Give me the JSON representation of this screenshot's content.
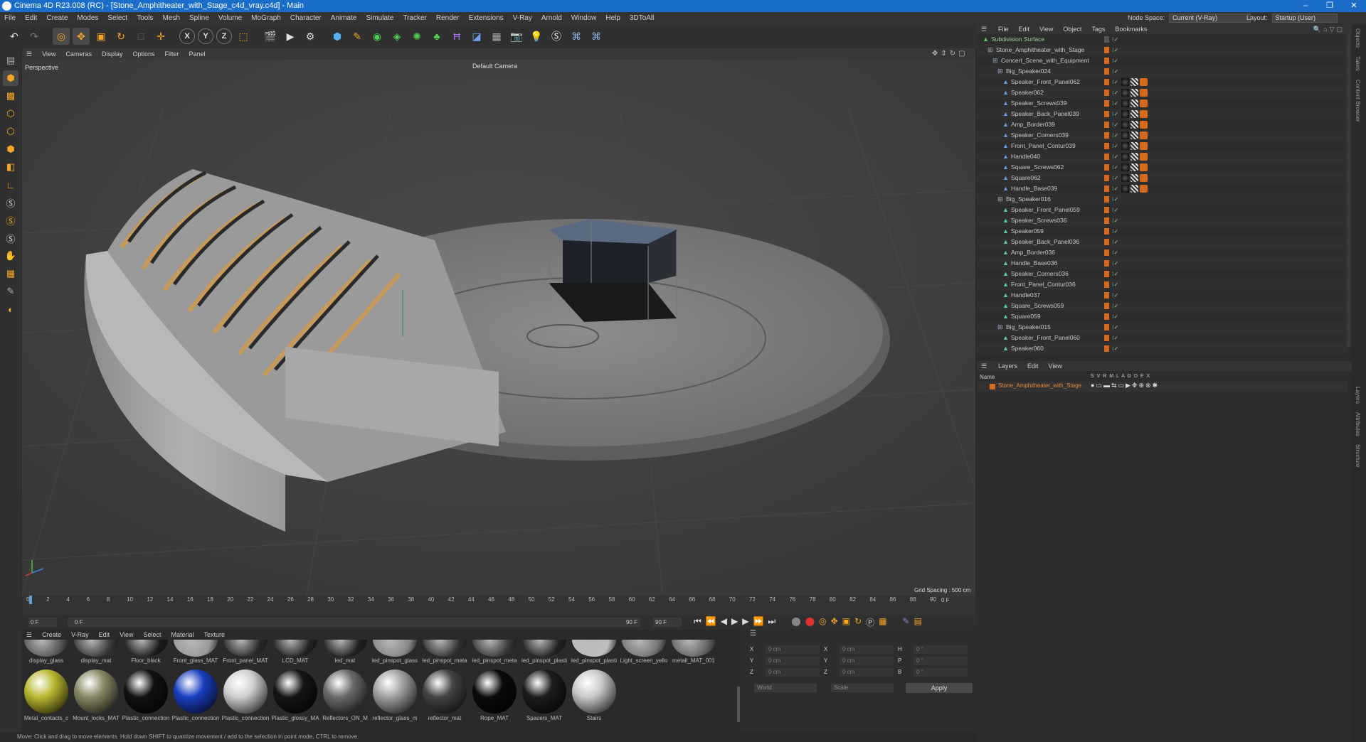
{
  "window": {
    "title": "Cinema 4D R23.008 (RC) - [Stone_Amphitheater_with_Stage_c4d_vray.c4d] - Main",
    "controls": [
      "–",
      "❐",
      "✕"
    ]
  },
  "menubar": {
    "items": [
      "File",
      "Edit",
      "Create",
      "Modes",
      "Select",
      "Tools",
      "Mesh",
      "Spline",
      "Volume",
      "MoGraph",
      "Character",
      "Animate",
      "Simulate",
      "Tracker",
      "Render",
      "Extensions",
      "V-Ray",
      "Arnold",
      "Window",
      "Help",
      "3DToAll"
    ],
    "node_space_label": "Node Space:",
    "node_space_value": "Current (V-Ray)",
    "layout_label": "Layout:",
    "layout_value": "Startup (User)"
  },
  "toolbar": {
    "axis": [
      "X",
      "Y",
      "Z"
    ]
  },
  "viewport": {
    "menu": [
      "View",
      "Cameras",
      "Display",
      "Options",
      "Filter",
      "Panel"
    ],
    "projection": "Perspective",
    "camera": "Default Camera",
    "grid_spacing": "Grid Spacing : 500 cm"
  },
  "timeline": {
    "ticks": [
      "0",
      "2",
      "4",
      "6",
      "8",
      "10",
      "12",
      "14",
      "16",
      "18",
      "20",
      "22",
      "24",
      "26",
      "28",
      "30",
      "32",
      "34",
      "36",
      "38",
      "40",
      "42",
      "44",
      "46",
      "48",
      "50",
      "52",
      "54",
      "56",
      "58",
      "60",
      "62",
      "64",
      "66",
      "68",
      "70",
      "72",
      "74",
      "76",
      "78",
      "80",
      "82",
      "84",
      "86",
      "88",
      "90"
    ],
    "frame_end_label": "0 F",
    "current_a": "0 F",
    "current_b": "0 F",
    "end_a": "90 F",
    "end_b": "90 F"
  },
  "materials": {
    "menu": [
      "Create",
      "V-Ray",
      "Edit",
      "View",
      "Select",
      "Material",
      "Texture"
    ],
    "row1": [
      {
        "name": "display_glass",
        "color": "#5a5a5a"
      },
      {
        "name": "display_mat",
        "color": "#3a3a3a"
      },
      {
        "name": "Floor_black",
        "color": "#1a1a1a"
      },
      {
        "name": "Front_glass_MAT",
        "color": "#9a9a9a"
      },
      {
        "name": "Front_panel_MAT",
        "color": "#2a2a2a"
      },
      {
        "name": "LCD_MAT",
        "color": "#222222"
      },
      {
        "name": "led_mat",
        "color": "#1e1e1e"
      },
      {
        "name": "led_pinspot_glass",
        "color": "#888888"
      },
      {
        "name": "led_pinspot_meta",
        "color": "#333333"
      },
      {
        "name": "led_pinspot_meta",
        "color": "#3a3a3a"
      },
      {
        "name": "led_pinspot_plasti",
        "color": "#222222"
      },
      {
        "name": "led_pinspot_plasti",
        "color": "#bdbdbd"
      },
      {
        "name": "Light_screen_yello",
        "color": "#777777"
      },
      {
        "name": "metall_MAT_001",
        "color": "#666666"
      }
    ],
    "row2": [
      {
        "name": "Metal_contacts_c",
        "color": "#b8b830"
      },
      {
        "name": "Mount_locks_MAT",
        "color": "#888866"
      },
      {
        "name": "Plastic_connection",
        "color": "#111111"
      },
      {
        "name": "Plastic_connection",
        "color": "#1a3fc0"
      },
      {
        "name": "Plastic_connection",
        "color": "#cfcfcf"
      },
      {
        "name": "Plastic_glossy_MA",
        "color": "#151515"
      },
      {
        "name": "Reflectors_ON_M",
        "color": "#6a6a6a"
      },
      {
        "name": "reflector_glass_m",
        "color": "#a0a0a0"
      },
      {
        "name": "reflector_mat",
        "color": "#444444"
      },
      {
        "name": "Rope_MAT",
        "color": "#0b0b0b"
      },
      {
        "name": "Spacers_MAT",
        "color": "#1c1c1c"
      },
      {
        "name": "Stairs",
        "color": "#c8c8c8"
      }
    ]
  },
  "coords": {
    "rows": [
      [
        "X",
        "0 cm",
        "X",
        "0 cm",
        "H",
        "0 °"
      ],
      [
        "Y",
        "0 cm",
        "Y",
        "0 cm",
        "P",
        "0 °"
      ],
      [
        "Z",
        "0 cm",
        "Z",
        "0 cm",
        "B",
        "0 °"
      ]
    ],
    "world": "World",
    "scale": "Scale",
    "apply": "Apply"
  },
  "status": "Move: Click and drag to move elements. Hold down SHIFT to quantize movement / add to the selection in point mode, CTRL to remove.",
  "objects": {
    "menu": [
      "File",
      "Edit",
      "View",
      "Object",
      "Tags",
      "Bookmarks"
    ],
    "rows": [
      {
        "name": "Subdivision Surface",
        "indent": 0,
        "type": "sub",
        "mats": 0
      },
      {
        "name": "Stone_Amphitheater_with_Stage",
        "indent": 1,
        "type": "null",
        "mats": 0
      },
      {
        "name": "Concert_Scene_with_Equipment",
        "indent": 2,
        "type": "null",
        "mats": 0
      },
      {
        "name": "Big_Speaker024",
        "indent": 3,
        "type": "null",
        "mats": 0
      },
      {
        "name": "Speaker_Front_Panel062",
        "indent": 4,
        "type": "poly",
        "mats": 3
      },
      {
        "name": "Speaker062",
        "indent": 4,
        "type": "poly",
        "mats": 3
      },
      {
        "name": "Speaker_Screws039",
        "indent": 4,
        "type": "poly",
        "mats": 3
      },
      {
        "name": "Speaker_Back_Panel039",
        "indent": 4,
        "type": "poly",
        "mats": 3
      },
      {
        "name": "Amp_Border039",
        "indent": 4,
        "type": "poly",
        "mats": 3
      },
      {
        "name": "Speaker_Corners039",
        "indent": 4,
        "type": "poly",
        "mats": 3
      },
      {
        "name": "Front_Panel_Contur039",
        "indent": 4,
        "type": "poly",
        "mats": 3
      },
      {
        "name": "Handle040",
        "indent": 4,
        "type": "poly",
        "mats": 3
      },
      {
        "name": "Square_Screws062",
        "indent": 4,
        "type": "poly",
        "mats": 3
      },
      {
        "name": "Square062",
        "indent": 4,
        "type": "poly",
        "mats": 3
      },
      {
        "name": "Handle_Base039",
        "indent": 4,
        "type": "poly",
        "mats": 3
      },
      {
        "name": "Big_Speaker016",
        "indent": 3,
        "type": "null",
        "mats": 0
      },
      {
        "name": "Speaker_Front_Panel059",
        "indent": 4,
        "type": "poly2",
        "mats": 0
      },
      {
        "name": "Speaker_Screws036",
        "indent": 4,
        "type": "poly2",
        "mats": 0
      },
      {
        "name": "Speaker059",
        "indent": 4,
        "type": "poly2",
        "mats": 0
      },
      {
        "name": "Speaker_Back_Panel036",
        "indent": 4,
        "type": "poly2",
        "mats": 0
      },
      {
        "name": "Amp_Border036",
        "indent": 4,
        "type": "poly2",
        "mats": 0
      },
      {
        "name": "Handle_Base036",
        "indent": 4,
        "type": "poly2",
        "mats": 0
      },
      {
        "name": "Speaker_Corners036",
        "indent": 4,
        "type": "poly2",
        "mats": 0
      },
      {
        "name": "Front_Panel_Contur036",
        "indent": 4,
        "type": "poly2",
        "mats": 0
      },
      {
        "name": "Handle037",
        "indent": 4,
        "type": "poly2",
        "mats": 0
      },
      {
        "name": "Square_Screws059",
        "indent": 4,
        "type": "poly2",
        "mats": 0
      },
      {
        "name": "Square059",
        "indent": 4,
        "type": "poly2",
        "mats": 0
      },
      {
        "name": "Big_Speaker015",
        "indent": 3,
        "type": "null",
        "mats": 0
      },
      {
        "name": "Speaker_Front_Panel060",
        "indent": 4,
        "type": "poly2",
        "mats": 0
      },
      {
        "name": "Speaker060",
        "indent": 4,
        "type": "poly2",
        "mats": 0
      }
    ]
  },
  "layers": {
    "menu": [
      "Layers",
      "Edit",
      "View"
    ],
    "name_header": "Name",
    "flags": "S V R M L A G D E X",
    "row": "Stone_Amphitheater_with_Stage"
  },
  "right_tabs": [
    "Objects",
    "Takes",
    "Content Browser",
    "Layers",
    "Attributes",
    "Structure"
  ]
}
